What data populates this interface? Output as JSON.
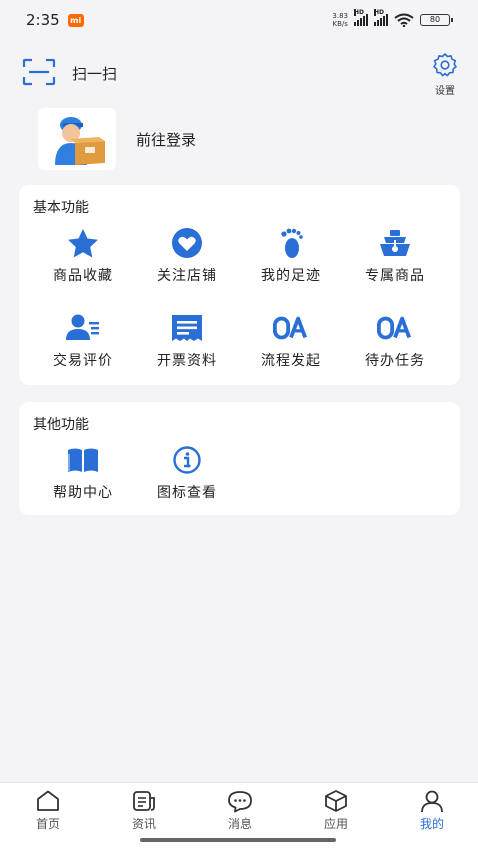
{
  "status_bar": {
    "time": "2:35",
    "mi_badge": "mi",
    "net_speed_value": "3.83",
    "net_speed_unit": "KB/s",
    "signal1_label": "HD",
    "signal2_label": "HD",
    "battery": "80"
  },
  "header": {
    "scan_label": "扫一扫",
    "settings_label": "设置"
  },
  "profile": {
    "login_text": "前往登录"
  },
  "basic_section": {
    "title": "基本功能",
    "items": [
      {
        "label": "商品收藏",
        "icon": "star-icon"
      },
      {
        "label": "关注店铺",
        "icon": "heart-icon"
      },
      {
        "label": "我的足迹",
        "icon": "footprint-icon"
      },
      {
        "label": "专属商品",
        "icon": "exclusive-goods-icon"
      },
      {
        "label": "交易评价",
        "icon": "user-review-icon"
      },
      {
        "label": "开票资料",
        "icon": "invoice-icon"
      },
      {
        "label": "流程发起",
        "icon": "oa-icon"
      },
      {
        "label": "待办任务",
        "icon": "oa-icon"
      }
    ]
  },
  "other_section": {
    "title": "其他功能",
    "items": [
      {
        "label": "帮助中心",
        "icon": "book-icon"
      },
      {
        "label": "图标查看",
        "icon": "info-icon"
      }
    ]
  },
  "tabbar": {
    "items": [
      {
        "label": "首页",
        "icon": "home-icon"
      },
      {
        "label": "资讯",
        "icon": "news-icon"
      },
      {
        "label": "消息",
        "icon": "message-icon"
      },
      {
        "label": "应用",
        "icon": "app-box-icon"
      },
      {
        "label": "我的",
        "icon": "profile-icon",
        "active": true
      }
    ]
  },
  "colors": {
    "accent": "#2a6fd6",
    "icon_blue": "#2a6fd6",
    "background": "#f4f4f6"
  }
}
